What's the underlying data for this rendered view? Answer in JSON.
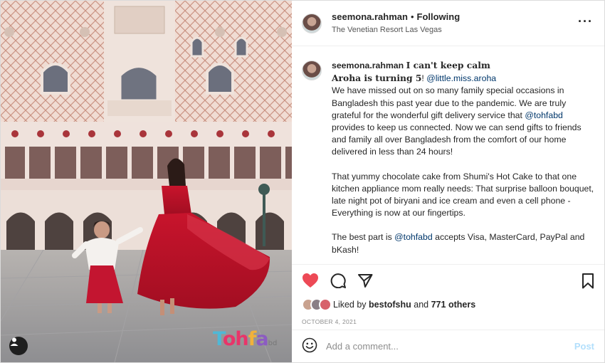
{
  "header": {
    "username": "seemona.rahman",
    "separator": "•",
    "follow_status": "Following",
    "location": "The Venetian Resort Las Vegas",
    "more_icon": "more-options-icon"
  },
  "caption": {
    "username": "seemona.rahman",
    "line1": "I can't keep calm",
    "line2_text": "Aroha is turning 5",
    "line2_punct": "! ",
    "mention1": "@little.miss.aroha",
    "p1_a": "We have missed out on so many family special occasions in Bangladesh this past year due to the pandemic. We are truly grateful for the wonderful gift delivery service that ",
    "mention2": "@tohfabd",
    "p1_b": " provides to keep us connected. Now we can send gifts to friends and family all over Bangladesh from the comfort of our home delivered in less than 24 hours!",
    "p2": "That yummy chocolate cake from Shumi's Hot Cake to that one kitchen appliance mom really needs: That surprise balloon bouquet, late night pot of biryani and ice cream and even a cell phone - Everything is now at our fingertips.",
    "p3_a": "The best part is ",
    "mention3": "@tohfabd",
    "p3_b": " accepts Visa, MasterCard, PayPal and bKash!"
  },
  "actions": {
    "like_icon": "heart-filled-icon",
    "comment_icon": "comment-icon",
    "share_icon": "share-icon",
    "save_icon": "bookmark-icon",
    "like_color": "#ed4956"
  },
  "likes": {
    "prefix": "Liked by",
    "user": "bestofshu",
    "conjunction": "and",
    "others": "771 others"
  },
  "date": "OCTOBER 4, 2021",
  "comment_box": {
    "placeholder": "Add a comment...",
    "post_label": "Post",
    "emoji_icon": "emoji-icon"
  },
  "photo": {
    "watermark_parts": [
      "T",
      "oh",
      "f",
      "a"
    ],
    "watermark_suffix": "bd",
    "tag_icon": "user-tag-icon"
  }
}
